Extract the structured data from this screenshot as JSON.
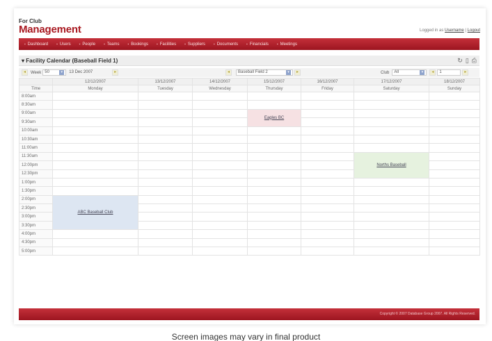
{
  "brand": {
    "line1": "For Club",
    "line2": "Management"
  },
  "login": {
    "prefix": "Logged in as",
    "user": "Username",
    "separator": "|",
    "logout": "Logout"
  },
  "nav": {
    "items": [
      {
        "label": "Dashboard"
      },
      {
        "label": "Users"
      },
      {
        "label": "People"
      },
      {
        "label": "Teams"
      },
      {
        "label": "Bookings"
      },
      {
        "label": "Facilities"
      },
      {
        "label": "Suppliers"
      },
      {
        "label": "Documents"
      },
      {
        "label": "Financials"
      },
      {
        "label": "Meetings"
      }
    ]
  },
  "panel": {
    "title": "Facility Calendar (Baseball Field 1)"
  },
  "filters": {
    "week_label": "Week",
    "week_value": "50",
    "date_value": "13 Dec 2007",
    "facility_value": "Baseball Field 2",
    "club_label": "Club",
    "club_value": "All",
    "page_value": "1"
  },
  "calendar": {
    "time_header": "Time",
    "dates": [
      "12/12/2007",
      "13/12/2007",
      "14/12/2007",
      "15/12/2007",
      "16/12/2007",
      "17/12/2007",
      "18/12/2007"
    ],
    "days": [
      "Monday",
      "Tuesday",
      "Wednesday",
      "Thursday",
      "Friday",
      "Saturday",
      "Sunday"
    ],
    "times": [
      "8:00am",
      "8:30am",
      "9:00am",
      "9:30am",
      "10:00am",
      "10:30am",
      "11:00am",
      "11:30am",
      "12:00pm",
      "12:30pm",
      "1:00pm",
      "1:30pm",
      "2:00pm",
      "2:30pm",
      "3:00pm",
      "3:30pm",
      "4:00pm",
      "4:30pm",
      "5:00pm"
    ],
    "bookings": [
      {
        "name": "Eagles BC",
        "day": "Thursday",
        "start": "9:00am",
        "end": "10:00am",
        "color": "#f6e1e3"
      },
      {
        "name": "Norths Baseball",
        "day": "Saturday",
        "start": "11:30am",
        "end": "1:00pm",
        "color": "#e6f2df"
      },
      {
        "name": "ABC Baseball Club",
        "day": "Monday",
        "start": "2:00pm",
        "end": "4:00pm",
        "color": "#dde6f2"
      }
    ]
  },
  "footer": {
    "copyright": "Copyright © 2007 Database Group 2007. All Rights Reserved."
  },
  "caption": "Screen images may vary in final product",
  "colors": {
    "brand_red": "#a81820",
    "nav_red": "#b2222c"
  }
}
